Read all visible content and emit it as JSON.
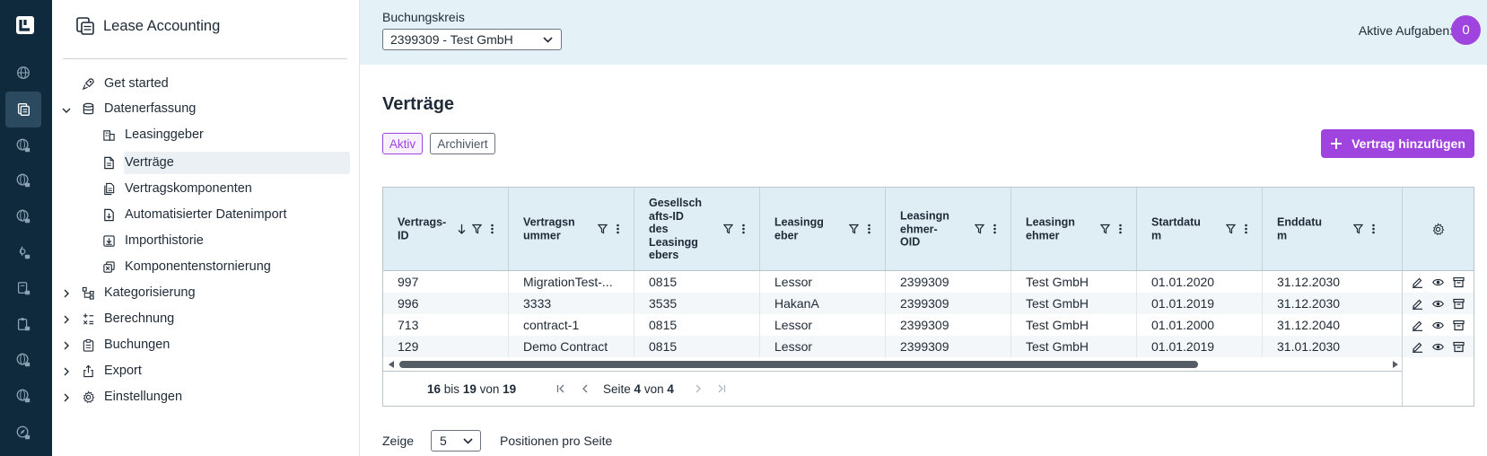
{
  "app": {
    "title": "Lease Accounting"
  },
  "rail": {
    "icons": [
      "logo-icon",
      "globe-icon",
      "files-icon",
      "globe-lock-icon",
      "globe-lock-icon",
      "globe-lock-icon",
      "lock-file-icon",
      "file-lock-icon",
      "clipboard-lock-icon",
      "globe-lock-icon",
      "globe-lock-icon",
      "compass-lock-icon"
    ]
  },
  "nav": {
    "items": [
      {
        "label": "Get started",
        "icon": "rocket-icon"
      },
      {
        "label": "Datenerfassung",
        "icon": "database-icon",
        "expanded": true
      },
      {
        "label": "Leasinggeber",
        "icon": "building-icon"
      },
      {
        "label": "Verträge",
        "icon": "document-icon",
        "selected": true
      },
      {
        "label": "Vertragskomponenten",
        "icon": "documents-icon"
      },
      {
        "label": "Automatisierter Datenimport",
        "icon": "file-import-icon"
      },
      {
        "label": "Importhistorie",
        "icon": "download-box-icon"
      },
      {
        "label": "Komponentenstornierung",
        "icon": "copy-cancel-icon"
      },
      {
        "label": "Kategorisierung",
        "icon": "hierarchy-icon"
      },
      {
        "label": "Berechnung",
        "icon": "calculator-icon"
      },
      {
        "label": "Buchungen",
        "icon": "clipboard-icon"
      },
      {
        "label": "Export",
        "icon": "export-icon"
      },
      {
        "label": "Einstellungen",
        "icon": "gear-icon"
      }
    ]
  },
  "topbar": {
    "buchungskreis_label": "Buchungskreis",
    "buchungskreis_value": "2399309 - Test GmbH",
    "tasks_label": "Aktive Aufgaben:",
    "tasks_count": "0",
    "accent": "#a044e0"
  },
  "page": {
    "title": "Verträge",
    "tag_active": "Aktiv",
    "tag_archived": "Archiviert",
    "add_button": "Vertrag hinzufügen"
  },
  "table": {
    "columns": [
      "Vertrags-ID",
      "Vertragsnummer",
      "Gesellschafts-ID des Leasinggebers",
      "Leasinggeber",
      "Leasingnehmer-OID",
      "Leasingnehmer",
      "Startdatum",
      "Enddatum"
    ],
    "column_display": [
      "Vertrags-\nID",
      "Vertragsn\nummer",
      "Gesellsch\nafts-ID\ndes\nLeasingg\nebers",
      "Leasingg\neber",
      "Leasingn\nehmer-\nOID",
      "Leasingn\nehmer",
      "Startdatu\nm",
      "Enddatu\nm"
    ],
    "rows": [
      [
        "997",
        "MigrationTest-...",
        "0815",
        "Lessor",
        "2399309",
        "Test GmbH",
        "01.01.2020",
        "31.12.2030"
      ],
      [
        "996",
        "3333",
        "3535",
        "HakanA",
        "2399309",
        "Test GmbH",
        "01.01.2019",
        "31.12.2030"
      ],
      [
        "713",
        "contract-1",
        "0815",
        "Lessor",
        "2399309",
        "Test GmbH",
        "01.01.2000",
        "31.12.2040"
      ],
      [
        "129",
        "Demo Contract",
        "0815",
        "Lessor",
        "2399309",
        "Test GmbH",
        "01.01.2019",
        "31.01.2030"
      ]
    ]
  },
  "paging": {
    "from": "16",
    "bis": "bis",
    "to": "19",
    "von": "von",
    "total": "19",
    "seite": "Seite",
    "page": "4",
    "page_von": "von",
    "pages": "4"
  },
  "page_size": {
    "label_before": "Zeige",
    "value": "5",
    "label_after": "Positionen pro Seite"
  }
}
